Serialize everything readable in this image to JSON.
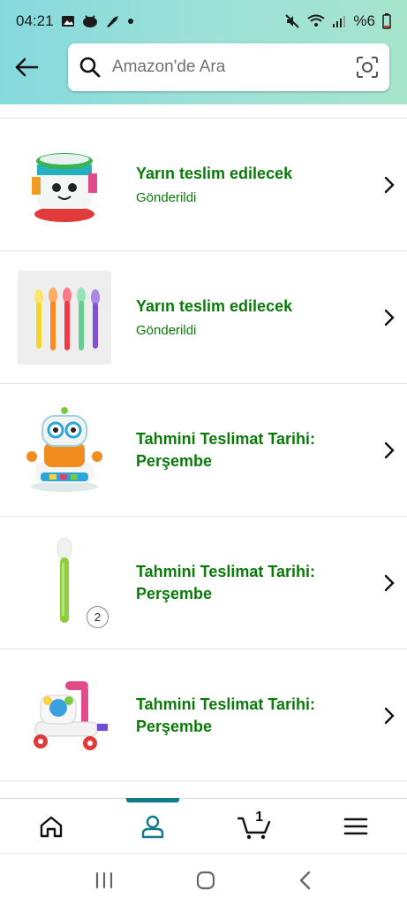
{
  "status_bar": {
    "time": "04:21",
    "battery": "%6"
  },
  "search": {
    "placeholder": "Amazon'de Ara"
  },
  "orders": [
    {
      "title": "Yarın teslim edilecek",
      "subtitle": "Gönderildi",
      "thumb": "drum-toy"
    },
    {
      "title": "Yarın teslim edilecek",
      "subtitle": "Gönderildi",
      "thumb": "baby-spoons"
    },
    {
      "title": "Tahmini Teslimat Tarihi: Perşembe",
      "subtitle": "",
      "thumb": "robot-toy"
    },
    {
      "title": "Tahmini Teslimat Tarihi: Perşembe",
      "subtitle": "",
      "thumb": "green-spoon",
      "quantity": "2"
    },
    {
      "title": "Tahmini Teslimat Tarihi: Perşembe",
      "subtitle": "",
      "thumb": "baby-walker"
    }
  ],
  "bottom_nav": {
    "items": [
      "home-icon",
      "account-icon",
      "cart-icon",
      "menu-icon"
    ],
    "active": "account-icon",
    "cart_count": "1"
  },
  "colors": {
    "accent": "#117a8b",
    "delivery_green": "#0a7a0a",
    "header_gradient_start": "#85d9dd",
    "header_gradient_end": "#a6e4cc"
  }
}
